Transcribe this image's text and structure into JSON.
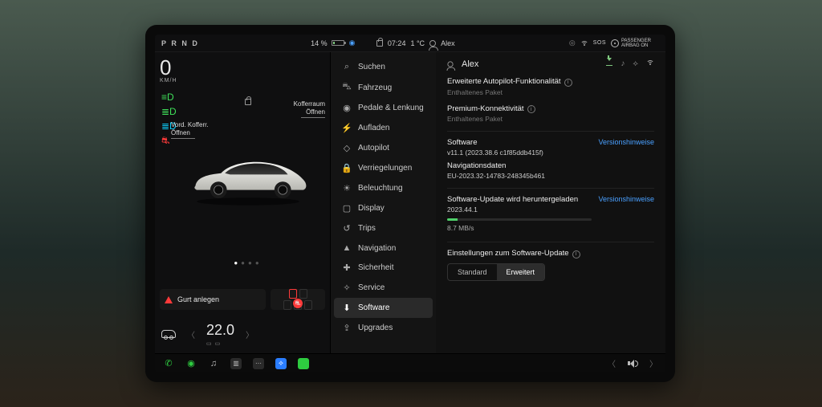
{
  "status": {
    "gear": "P R N D",
    "battery_pct": "14 %",
    "time": "07:24",
    "temperature": "1 °C",
    "profile": "Alex",
    "sos": "SOS",
    "airbag": "PASSENGER AIRBAG ON"
  },
  "left": {
    "speed": "0",
    "speed_unit": "KM/H",
    "frunk_label_l1": "Vord. Kofferr.",
    "frunk_label_l2": "Öffnen",
    "trunk_label_l1": "Kofferraum",
    "trunk_label_l2": "Öffnen",
    "warning": "Gurt anlegen",
    "temperature": "22.0"
  },
  "menu": {
    "items": [
      {
        "icon": "⌕",
        "label": "Suchen"
      },
      {
        "icon": "⛍",
        "label": "Fahrzeug"
      },
      {
        "icon": "◉",
        "label": "Pedale & Lenkung"
      },
      {
        "icon": "⚡",
        "label": "Aufladen"
      },
      {
        "icon": "◇",
        "label": "Autopilot"
      },
      {
        "icon": "🔒",
        "label": "Verriegelungen"
      },
      {
        "icon": "☀",
        "label": "Beleuchtung"
      },
      {
        "icon": "▢",
        "label": "Display"
      },
      {
        "icon": "↺",
        "label": "Trips"
      },
      {
        "icon": "▲",
        "label": "Navigation"
      },
      {
        "icon": "✚",
        "label": "Sicherheit"
      },
      {
        "icon": "✧",
        "label": "Service"
      },
      {
        "icon": "⬇",
        "label": "Software"
      },
      {
        "icon": "⇪",
        "label": "Upgrades"
      }
    ],
    "active_index": 12
  },
  "right": {
    "profile": "Alex",
    "pkg1_title": "Erweiterte Autopilot-Funktionalität",
    "pkg1_sub": "Enthaltenes Paket",
    "pkg2_title": "Premium-Konnektivität",
    "pkg2_sub": "Enthaltenes Paket",
    "software_label": "Software",
    "software_version": "v11.1 (2023.38.6 c1f85ddb415f)",
    "nav_label": "Navigationsdaten",
    "nav_version": "EU-2023.32-14783-248345b461",
    "release_notes": "Versionshinweise",
    "update_label": "Software-Update wird heruntergeladen",
    "update_version": "2023.44.1",
    "dl_speed": "8.7 MB/s",
    "settings_label": "Einstellungen zum Software-Update",
    "seg_standard": "Standard",
    "seg_advanced": "Erweitert"
  }
}
